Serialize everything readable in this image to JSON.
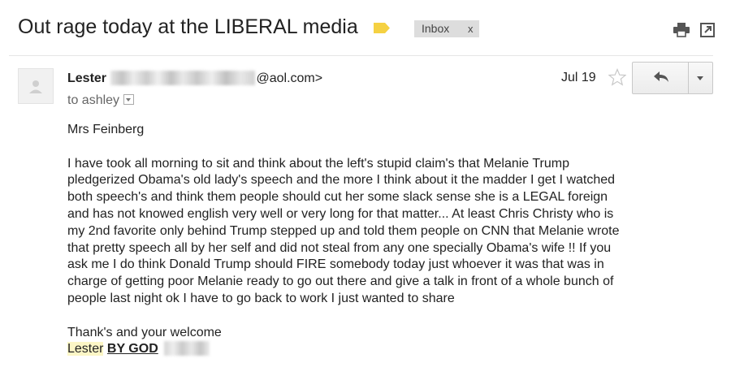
{
  "subject": "Out rage today at the LIBERAL media",
  "label_chip": {
    "text": "Inbox",
    "remove": "x"
  },
  "colors": {
    "label_tag": "#f5d142",
    "signature_highlight": "#fcf6c6"
  },
  "icons": {
    "print": "print-icon",
    "popout": "popout-icon",
    "star": "star-icon",
    "reply": "reply-icon",
    "more": "chevron-down-icon",
    "avatar": "person-icon"
  },
  "sender": {
    "name": "Lester",
    "email_suffix": "@aol.com>"
  },
  "recipient_line": "to ashley",
  "date": "Jul 19",
  "body": {
    "greeting": "Mrs Feinberg",
    "paragraph_lines": [
      "I have took all morning to sit and think about the left's stupid claim's that Melanie Trump",
      "pledgerized Obama's old lady's speech and the more I think about it the madder I get I watched",
      "both speech's and think them people should cut her some slack sense she is a LEGAL foreign",
      "and has not knowed english very well or very long for that matter... At least Chris Christy who is",
      "my 2nd favorite only behind Trump stepped up and told them people on CNN that Melanie wrote",
      "that pretty speech all by her self and did not steal from any one specially Obama's wife !! If you",
      "ask me I do think Donald Trump should FIRE somebody today just whoever it was that was in",
      "charge of getting poor Melanie ready to go out there and give a talk in front of a whole bunch of",
      "people last night ok I have to go back to work I just wanted to share"
    ],
    "closing": "Thank's and your welcome",
    "signature": {
      "name": "Lester",
      "emphasis": "BY GOD"
    }
  }
}
